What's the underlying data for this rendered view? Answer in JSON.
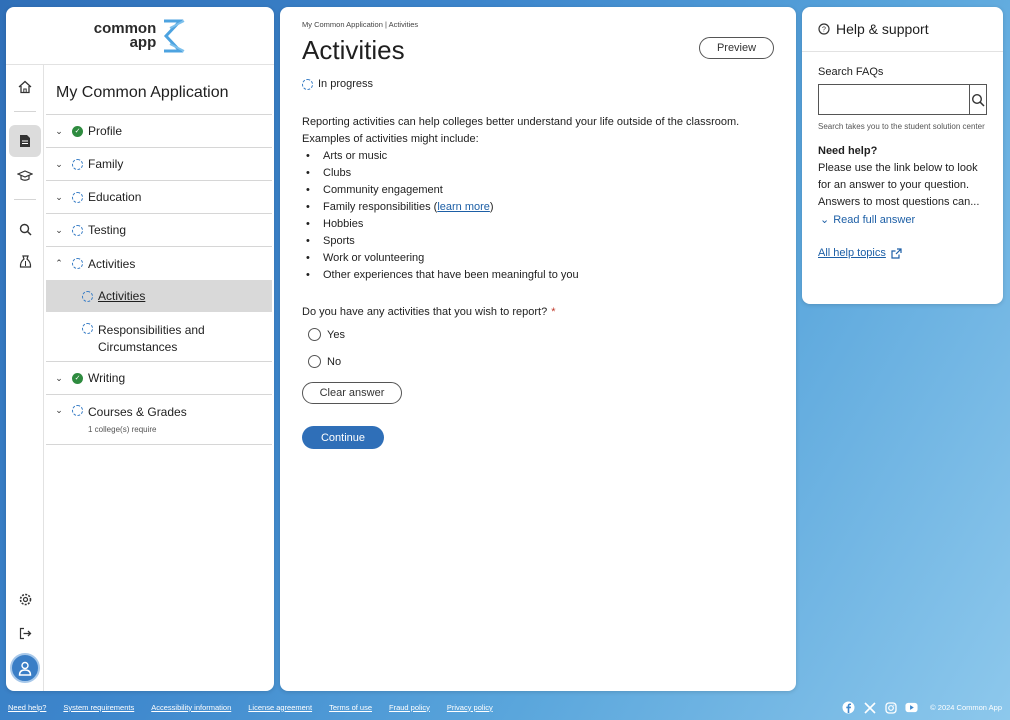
{
  "brand": {
    "logo_line1": "common",
    "logo_line2": "app"
  },
  "nav": {
    "title": "My Common Application",
    "sections": [
      {
        "label": "Profile",
        "status": "complete"
      },
      {
        "label": "Family",
        "status": "in-progress"
      },
      {
        "label": "Education",
        "status": "in-progress"
      },
      {
        "label": "Testing",
        "status": "in-progress"
      },
      {
        "label": "Activities",
        "status": "in-progress",
        "expanded": true
      },
      {
        "label": "Writing",
        "status": "complete"
      },
      {
        "label": "Courses & Grades",
        "status": "in-progress",
        "note": "1 college(s) require"
      }
    ],
    "subsections": [
      {
        "label": "Activities",
        "selected": true
      },
      {
        "label_line1": "Responsibilities and",
        "label_line2": "Circumstances"
      }
    ]
  },
  "rail": {
    "items": [
      "home-icon",
      "document-icon",
      "graduation-cap-icon",
      "search-icon",
      "money-bag-icon",
      "settings-icon",
      "sign-out-icon",
      "user-avatar-icon"
    ]
  },
  "main": {
    "breadcrumb": "My Common Application | Activities",
    "title": "Activities",
    "preview_label": "Preview",
    "status": "In progress",
    "intro_line1": "Reporting activities can help colleges better understand your life outside of the classroom.",
    "intro_line2": "Examples of activities might include:",
    "examples": [
      "Arts or music",
      "Clubs",
      "Community engagement",
      "Family responsibilities (",
      "Hobbies",
      "Sports",
      "Work or volunteering",
      "Other experiences that have been meaningful to you"
    ],
    "learn_more": "learn more",
    "learn_more_close": ")",
    "question": "Do you have any activities that you wish to report?",
    "required_mark": "*",
    "options": [
      "Yes",
      "No"
    ],
    "clear_label": "Clear answer",
    "continue_label": "Continue"
  },
  "help": {
    "title": "Help & support",
    "faq_label": "Search FAQs",
    "search_value": "",
    "hint": "Search takes you to the student solution center",
    "need_help": "Need help?",
    "text": "Please use the link below to look for an answer to your question. Answers to most questions can...",
    "read_full": "Read full answer",
    "all_topics": "All help topics"
  },
  "footer": {
    "links": [
      "Need help?",
      "System requirements",
      "Accessibility information",
      "License agreement",
      "Terms of use",
      "Fraud policy",
      "Privacy policy"
    ],
    "socials": [
      "facebook-icon",
      "x-icon",
      "instagram-icon",
      "youtube-icon"
    ],
    "copyright": "© 2024 Common App"
  },
  "colors": {
    "accent": "#2f6fb8",
    "complete": "#2e8b3f",
    "link": "#1d5fa6",
    "required": "#c0392b"
  }
}
